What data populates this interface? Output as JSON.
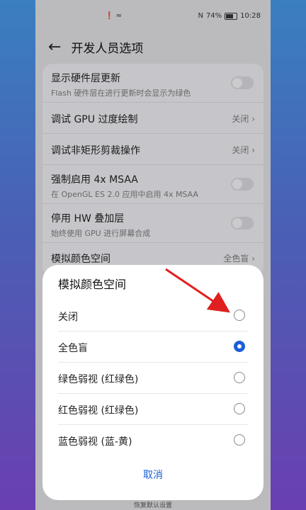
{
  "status_bar": {
    "left_icons": "❗ ≈",
    "nfc": "N",
    "battery": "74%",
    "time": "10:28"
  },
  "header": {
    "back_icon": "←",
    "title": "开发人员选项"
  },
  "settings": [
    {
      "label": "显示硬件层更新",
      "sub": "Flash 硬件层在进行更新时会显示为绿色",
      "type": "toggle"
    },
    {
      "label": "调试 GPU 过度绘制",
      "value": "关闭",
      "type": "value"
    },
    {
      "label": "调试非矩形剪裁操作",
      "value": "关闭",
      "type": "value"
    },
    {
      "label": "强制启用 4x MSAA",
      "sub": "在 OpenGL ES 2.0 应用中启用 4x MSAA",
      "type": "toggle"
    },
    {
      "label": "停用 HW 叠加层",
      "sub": "始终使用 GPU 进行屏幕合成",
      "type": "toggle"
    },
    {
      "label": "模拟颜色空间",
      "value": "全色盲",
      "type": "value"
    }
  ],
  "chevron": "›",
  "dialog": {
    "title": "模拟颜色空间",
    "options": [
      {
        "label": "关闭",
        "selected": false
      },
      {
        "label": "全色盲",
        "selected": true
      },
      {
        "label": "绿色弱视 (红绿色)",
        "selected": false
      },
      {
        "label": "红色弱视 (红绿色)",
        "selected": false
      },
      {
        "label": "蓝色弱视 (蓝-黄)",
        "selected": false
      }
    ],
    "cancel": "取消"
  },
  "bottom_hint": "恢复默认设置",
  "colors": {
    "accent": "#1a5fd6",
    "arrow": "#e02020"
  }
}
